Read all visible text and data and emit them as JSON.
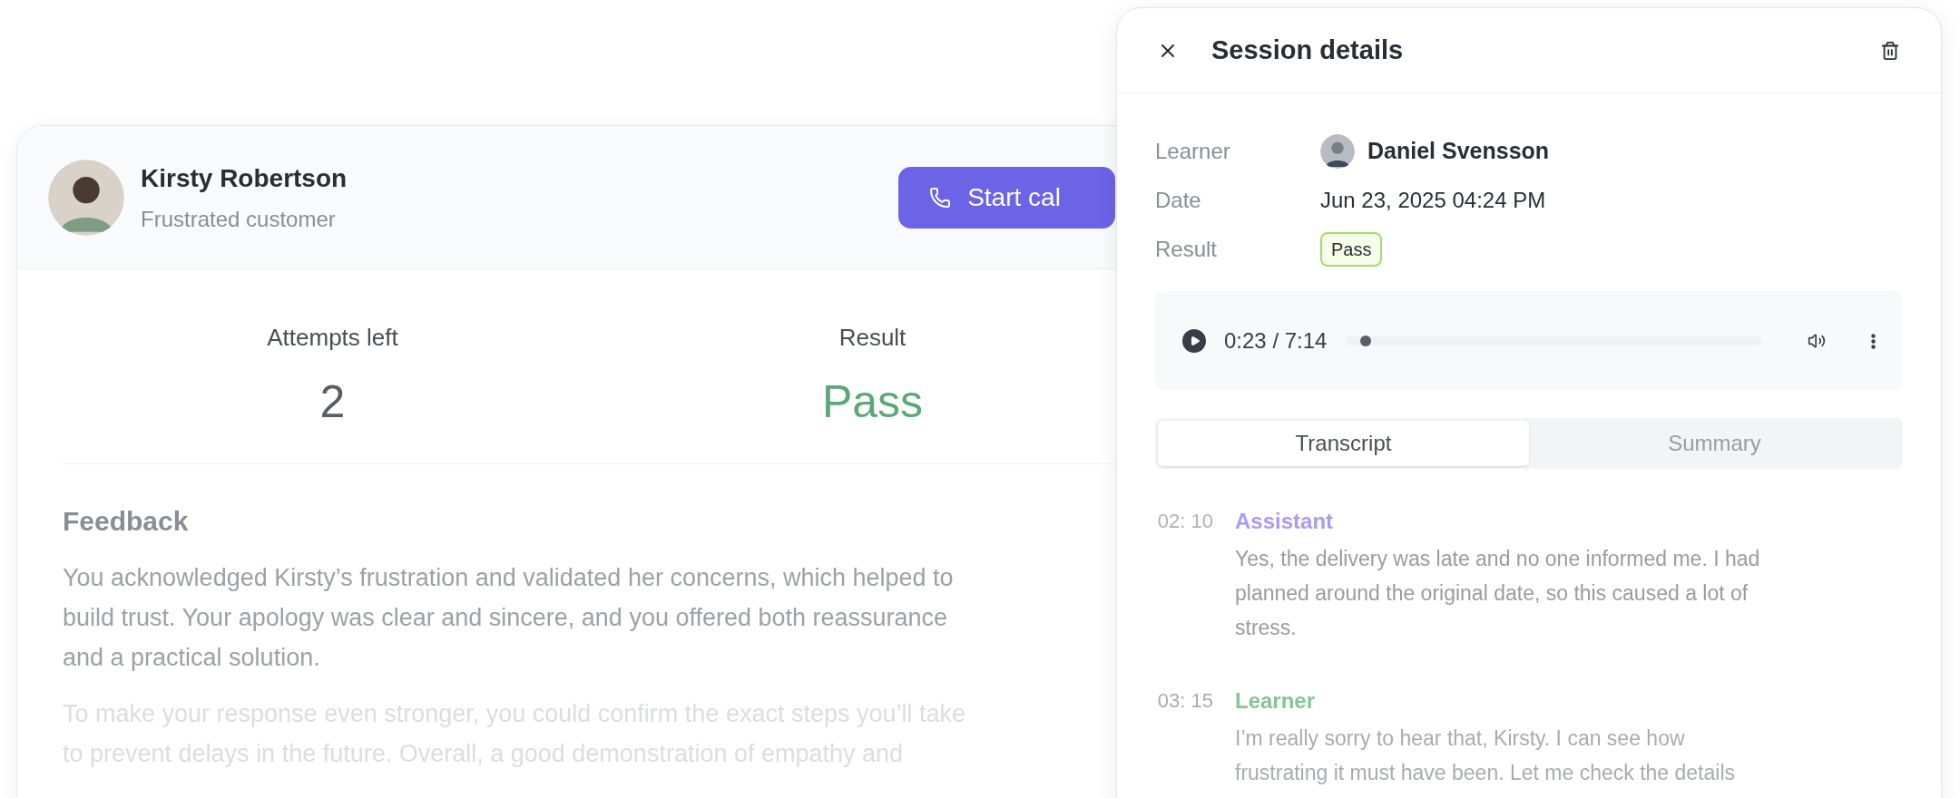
{
  "card": {
    "name": "Kirsty Robertson",
    "role": "Frustrated customer",
    "call_button": "Start cal",
    "stats": [
      {
        "label": "Attempts left",
        "value": "2",
        "kind": "neutral"
      },
      {
        "label": "Result",
        "value": "Pass",
        "kind": "success"
      }
    ],
    "feedback": {
      "title": "Feedback",
      "paragraphs": [
        {
          "lines": [
            "You acknowledged Kirsty’s frustration and validated her concerns, which helped to",
            "build trust. Your apology was clear and sincere, and you offered both reassurance",
            "and a practical solution."
          ]
        },
        {
          "lines": [
            "To make your response even stronger, you could confirm the exact steps you’ll take",
            "to prevent delays in the future. Overall, a good demonstration of empathy and"
          ]
        }
      ]
    }
  },
  "panel": {
    "title": "Session details",
    "fields": [
      {
        "label": "Learner",
        "value": "Daniel Svensson",
        "kind": "person"
      },
      {
        "label": "Date",
        "value": "Jun 23, 2025 04:24 PM",
        "kind": "text"
      },
      {
        "label": "Result",
        "value": "Pass",
        "kind": "badge"
      }
    ],
    "player": {
      "time": "0:23 / 7:14",
      "level": 0.05
    },
    "tabs": [
      {
        "label": "Transcript",
        "selected": true
      },
      {
        "label": "Summary",
        "selected": false
      }
    ],
    "messages": [
      {
        "time": "02: 10",
        "speaker": "Assistant",
        "color": "#a99cf0",
        "lines": [
          "Yes, the delivery was late and no one informed me. I had",
          "planned around the original date, so this caused a lot of",
          "stress."
        ]
      },
      {
        "time": "03: 15",
        "speaker": "Learner",
        "color": "#86c497",
        "lines": [
          "I’m really sorry to hear that, Kirsty. I can see how",
          "frustrating it must have been. Let me check the details"
        ]
      }
    ]
  }
}
